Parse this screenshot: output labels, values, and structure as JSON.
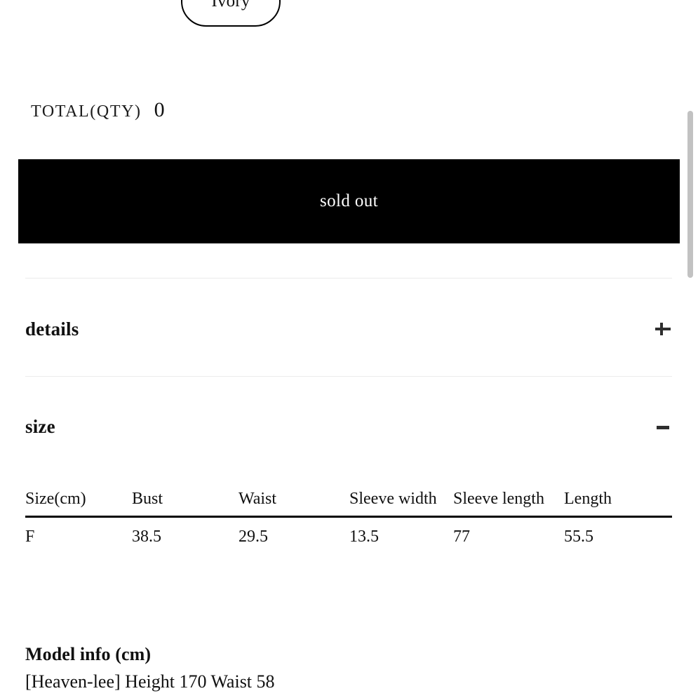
{
  "product_options": {
    "selected_option": {
      "label": "Ivory",
      "icon": "option-pill"
    }
  },
  "total": {
    "label": "TOTAL(QTY)",
    "value": "0"
  },
  "purchase": {
    "sold_out_label": "sold out",
    "button_bg": "#000000",
    "button_text_color": "#ffffff"
  },
  "accordions": [
    {
      "key": "details",
      "title": "details",
      "toggle_icon": "plus-icon",
      "expanded": false
    },
    {
      "key": "size",
      "title": "size",
      "toggle_icon": "minus-icon",
      "expanded": true
    }
  ],
  "size_table": {
    "headers": [
      "Size(cm)",
      "Bust",
      "Waist",
      "Sleeve width",
      "Sleeve length",
      "Length"
    ],
    "rows": [
      [
        "F",
        "38.5",
        "29.5",
        "13.5",
        "77",
        "55.5"
      ]
    ]
  },
  "model_info": {
    "title": "Model info (cm)",
    "lines": [
      "[Heaven-lee] Height 170 Waist 58"
    ]
  },
  "scrollbar": {
    "thumb_color": "#c2c2c2"
  }
}
